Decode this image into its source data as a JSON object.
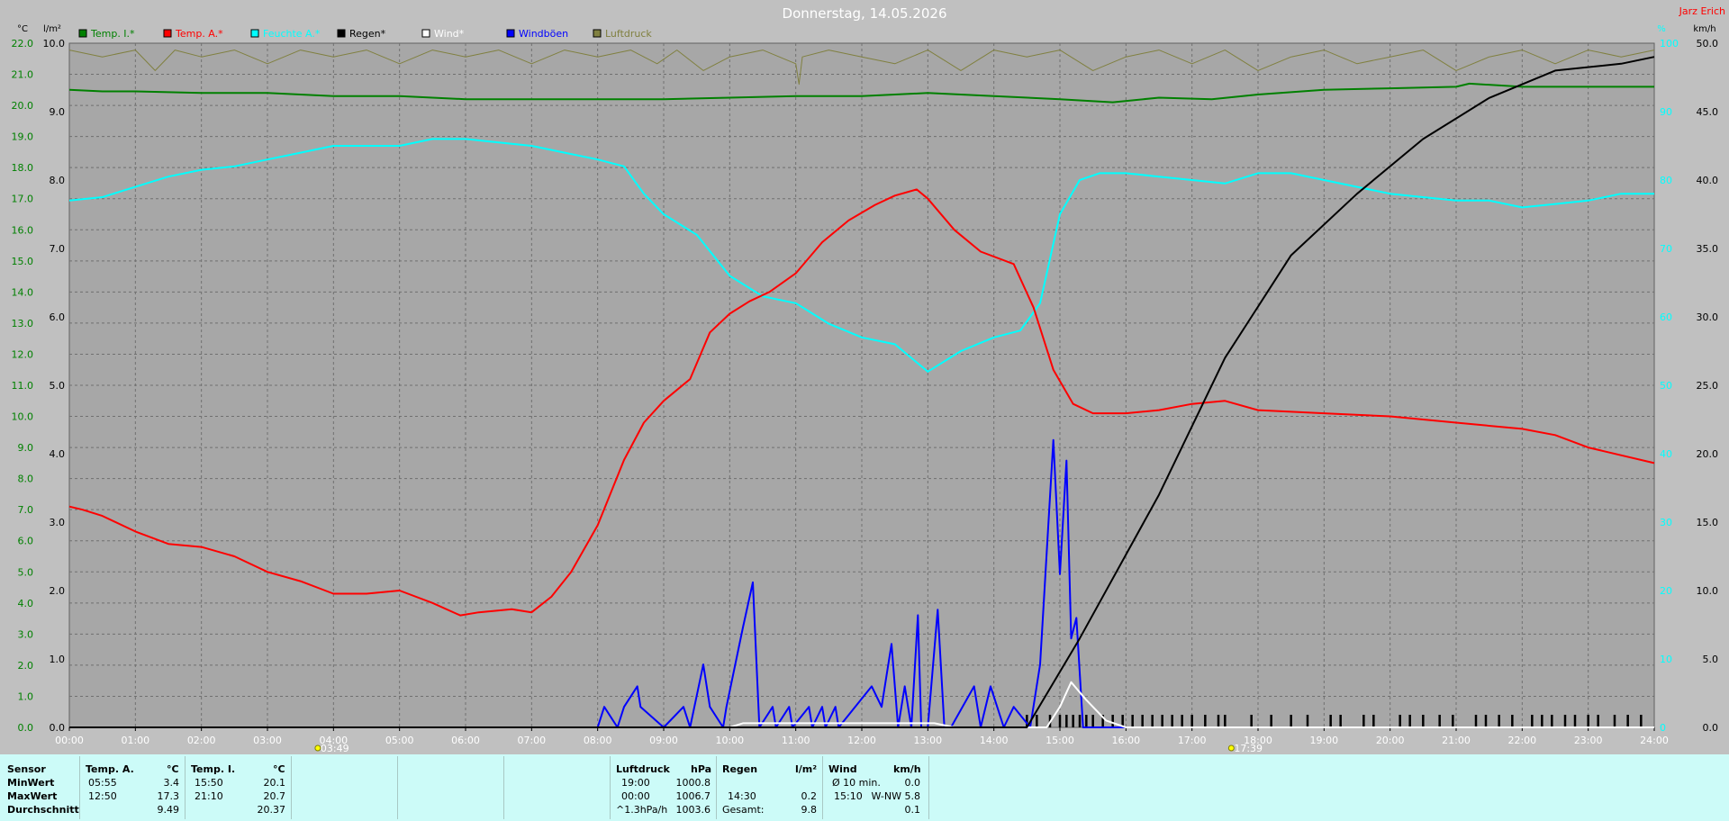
{
  "header": {
    "title": "Donnerstag, 14.05.2026",
    "author": "Jarz Erich",
    "left_unit_temp": "°C",
    "left_unit_rain": "l/m²",
    "right_unit_pct": "%",
    "right_unit_wind": "km/h"
  },
  "legend": [
    {
      "label": "Temp. I.*",
      "color": "#008000"
    },
    {
      "label": "Temp. A.*",
      "color": "#ff0000"
    },
    {
      "label": "Feuchte A.*",
      "color": "#00ffff"
    },
    {
      "label": "Regen*",
      "color": "#000000"
    },
    {
      "label": "Wind*",
      "color": "#ffffff"
    },
    {
      "label": "Windböen",
      "color": "#0000ff"
    },
    {
      "label": "Luftdruck",
      "color": "#808040"
    }
  ],
  "sun": {
    "sunrise": "03:49",
    "sunset": "17:39"
  },
  "chart_data": {
    "type": "line",
    "title": "Donnerstag, 14.05.2026",
    "x_unit": "hours",
    "xlim": [
      0,
      24
    ],
    "x_ticks": [
      "00:00",
      "01:00",
      "02:00",
      "03:00",
      "04:00",
      "05:00",
      "06:00",
      "07:00",
      "08:00",
      "09:00",
      "10:00",
      "11:00",
      "12:00",
      "13:00",
      "14:00",
      "15:00",
      "16:00",
      "17:00",
      "18:00",
      "19:00",
      "20:00",
      "21:00",
      "22:00",
      "23:00",
      "24:00"
    ],
    "axes": {
      "temp_c": {
        "range": [
          0,
          22
        ],
        "ticks": [
          "0.0",
          "1.0",
          "2.0",
          "3.0",
          "4.0",
          "5.0",
          "6.0",
          "7.0",
          "8.0",
          "9.0",
          "10.0",
          "11.0",
          "12.0",
          "13.0",
          "14.0",
          "15.0",
          "16.0",
          "17.0",
          "18.0",
          "19.0",
          "20.0",
          "21.0",
          "22.0"
        ]
      },
      "rain_lm2": {
        "range": [
          0,
          10
        ],
        "ticks": [
          "0.0",
          "1.0",
          "2.0",
          "3.0",
          "4.0",
          "5.0",
          "6.0",
          "7.0",
          "8.0",
          "9.0",
          "10.0"
        ]
      },
      "humidity_pct": {
        "range": [
          0,
          100
        ],
        "ticks": [
          "0",
          "10",
          "20",
          "30",
          "40",
          "50",
          "60",
          "70",
          "80",
          "90",
          "100"
        ]
      },
      "wind_kmh": {
        "range": [
          0,
          50
        ],
        "ticks": [
          "0.0",
          "5.0",
          "10.0",
          "15.0",
          "20.0",
          "25.0",
          "30.0",
          "35.0",
          "40.0",
          "45.0",
          "50.0"
        ]
      }
    },
    "grid": true,
    "series": [
      {
        "name": "Temp. I.*",
        "axis": "temp_c",
        "color": "#008000",
        "x": [
          0,
          0.5,
          1,
          2,
          3,
          4,
          5,
          6,
          7,
          8,
          9,
          10,
          11,
          12,
          13,
          14,
          15,
          15.8,
          16.5,
          17.3,
          18,
          19,
          20,
          21,
          21.2,
          22,
          23,
          24
        ],
        "y": [
          20.5,
          20.45,
          20.45,
          20.4,
          20.4,
          20.3,
          20.3,
          20.2,
          20.2,
          20.2,
          20.2,
          20.25,
          20.3,
          20.3,
          20.4,
          20.3,
          20.2,
          20.1,
          20.25,
          20.2,
          20.35,
          20.5,
          20.55,
          20.6,
          20.7,
          20.6,
          20.6,
          20.6
        ]
      },
      {
        "name": "Temp. A.*",
        "axis": "temp_c",
        "color": "#ff0000",
        "x": [
          0,
          0.2,
          0.5,
          1,
          1.5,
          2,
          2.5,
          3,
          3.5,
          4,
          4.5,
          5,
          5.5,
          5.92,
          6.2,
          6.7,
          7,
          7.3,
          7.6,
          8,
          8.4,
          8.7,
          9,
          9.4,
          9.7,
          10,
          10.3,
          10.6,
          11,
          11.4,
          11.8,
          12.2,
          12.5,
          12.83,
          13,
          13.4,
          13.8,
          14.3,
          14.6,
          14.9,
          15.2,
          15.5,
          16,
          16.5,
          17,
          17.5,
          18,
          19,
          20,
          21,
          22,
          22.5,
          23,
          24
        ],
        "y": [
          7.1,
          7.0,
          6.8,
          6.3,
          5.9,
          5.8,
          5.5,
          5.0,
          4.7,
          4.3,
          4.3,
          4.4,
          4.0,
          3.6,
          3.7,
          3.8,
          3.7,
          4.2,
          5.0,
          6.5,
          8.6,
          9.8,
          10.5,
          11.2,
          12.7,
          13.3,
          13.7,
          14.0,
          14.6,
          15.6,
          16.3,
          16.8,
          17.1,
          17.3,
          17.0,
          16.0,
          15.3,
          14.9,
          13.5,
          11.5,
          10.4,
          10.1,
          10.1,
          10.2,
          10.4,
          10.5,
          10.2,
          10.1,
          10.0,
          9.8,
          9.6,
          9.4,
          9.0,
          8.5
        ]
      },
      {
        "name": "Feuchte A.*",
        "axis": "humidity_pct",
        "color": "#00ffff",
        "x": [
          0,
          0.5,
          1,
          1.5,
          2,
          2.5,
          3,
          3.5,
          4,
          4.5,
          5,
          5.5,
          6,
          6.5,
          7,
          7.5,
          8,
          8.4,
          8.7,
          9,
          9.5,
          10,
          10.5,
          11,
          11.5,
          12,
          12.5,
          13,
          13.5,
          14,
          14.4,
          14.7,
          15,
          15.3,
          15.6,
          16,
          16.5,
          17,
          17.5,
          18,
          18.5,
          19,
          19.5,
          20,
          20.5,
          21,
          21.5,
          22,
          22.5,
          23,
          23.5,
          24
        ],
        "y": [
          77,
          77.5,
          79,
          80.5,
          81.5,
          82,
          83,
          84,
          85,
          85,
          85,
          86,
          86,
          85.5,
          85,
          84,
          83,
          82,
          78,
          75,
          72,
          66,
          63,
          62,
          59,
          57,
          56,
          52,
          55,
          57,
          58,
          62,
          75,
          80,
          81,
          81,
          80.5,
          80,
          79.5,
          81,
          81,
          80,
          79,
          78,
          77.5,
          77,
          77,
          76,
          76.5,
          77,
          78,
          78
        ]
      },
      {
        "name": "Regen*",
        "axis": "rain_lm2",
        "color": "#000000",
        "x": [
          0,
          14.5,
          15.3,
          16.5,
          17.5,
          18.5,
          19.5,
          20.5,
          21.5,
          22.5,
          23.5,
          24
        ],
        "y": [
          0,
          0,
          1.3,
          3.4,
          5.4,
          6.9,
          7.8,
          8.6,
          9.2,
          9.6,
          9.7,
          9.8
        ]
      },
      {
        "name": "Wind*",
        "axis": "wind_kmh",
        "color": "#ffffff",
        "x": [
          0,
          10.0,
          10.2,
          13.1,
          13.4,
          14.8,
          15.0,
          15.17,
          15.4,
          15.7,
          16.0,
          24
        ],
        "y": [
          0,
          0,
          0.3,
          0.3,
          0,
          0,
          1.5,
          3.3,
          2.0,
          0.5,
          0,
          0
        ]
      },
      {
        "name": "Windböen",
        "axis": "wind_kmh",
        "color": "#0000ff",
        "x": [
          0,
          8.0,
          8.1,
          8.3,
          8.4,
          8.6,
          8.65,
          9.0,
          9.3,
          9.4,
          9.6,
          9.7,
          9.9,
          9.95,
          10.2,
          10.35,
          10.45,
          10.65,
          10.7,
          10.9,
          10.95,
          11.2,
          11.25,
          11.4,
          11.45,
          11.6,
          11.65,
          12.15,
          12.3,
          12.45,
          12.55,
          12.65,
          12.75,
          12.85,
          12.9,
          13.0,
          13.15,
          13.25,
          13.35,
          13.7,
          13.8,
          13.95,
          14.15,
          14.3,
          14.55,
          14.7,
          14.9,
          15.0,
          15.1,
          15.17,
          15.25,
          15.35,
          15.45,
          15.6,
          24
        ],
        "y": [
          0,
          0,
          1.5,
          0,
          1.5,
          3.0,
          1.5,
          0,
          1.5,
          0,
          4.6,
          1.5,
          0,
          1.5,
          7.3,
          10.6,
          0,
          1.5,
          0,
          1.5,
          0,
          1.5,
          0,
          1.5,
          0,
          1.5,
          0,
          3.0,
          1.5,
          6.1,
          0,
          3.0,
          0,
          8.2,
          0,
          0,
          8.6,
          0,
          0,
          3.0,
          0,
          3.0,
          0,
          1.5,
          0,
          4.6,
          21.0,
          11.2,
          19.5,
          6.5,
          8.0,
          0,
          0,
          0,
          0
        ]
      },
      {
        "name": "Luftdruck",
        "axis": "humidity_pct",
        "color": "#808040",
        "x": [
          0,
          0.5,
          1,
          1.3,
          1.6,
          2,
          2.5,
          3,
          3.5,
          4,
          4.5,
          5,
          5.5,
          6,
          6.5,
          7,
          7.5,
          8,
          8.5,
          8.9,
          9.2,
          9.6,
          10,
          10.5,
          11,
          11.05,
          11.1,
          11.5,
          12,
          12.5,
          13,
          13.5,
          14,
          14.5,
          15,
          15.5,
          16,
          16.5,
          17,
          17.5,
          18,
          18.5,
          19,
          19.5,
          20,
          20.5,
          21,
          21.5,
          22,
          22.5,
          23,
          23.5,
          24
        ],
        "y": [
          99,
          98,
          99,
          96,
          99,
          98,
          99,
          97,
          99,
          98,
          99,
          97,
          99,
          98,
          99,
          97,
          99,
          98,
          99,
          97,
          99,
          96,
          98,
          99,
          97,
          94,
          98,
          99,
          98,
          97,
          99,
          96,
          99,
          98,
          99,
          96,
          98,
          99,
          97,
          99,
          96,
          98,
          99,
          97,
          98,
          99,
          96,
          98,
          99,
          97,
          99,
          98,
          99
        ]
      }
    ],
    "rain_marks_hours": [
      14.5,
      14.65,
      14.85,
      15.0,
      15.1,
      15.2,
      15.3,
      15.4,
      15.5,
      15.65,
      15.8,
      15.95,
      16.1,
      16.25,
      16.4,
      16.55,
      16.7,
      16.85,
      17.0,
      17.2,
      17.4,
      17.5,
      17.9,
      18.2,
      18.5,
      18.75,
      19.1,
      19.25,
      19.6,
      19.75,
      20.15,
      20.3,
      20.5,
      20.75,
      20.95,
      21.3,
      21.45,
      21.65,
      21.85,
      22.15,
      22.3,
      22.45,
      22.65,
      22.8,
      23.0,
      23.15,
      23.4,
      23.6,
      23.8
    ]
  },
  "stats": {
    "labels": {
      "sensor": "Sensor",
      "min": "MinWert",
      "max": "MaxWert",
      "avg": "Durchschnitt"
    },
    "temp_a": {
      "title": "Temp. A.",
      "unit": "°C",
      "min_time": "05:55",
      "min_val": "3.4",
      "max_time": "12:50",
      "max_val": "17.3",
      "avg": "9.49"
    },
    "temp_i": {
      "title": "Temp. I.",
      "unit": "°C",
      "min_time": "15:50",
      "min_val": "20.1",
      "max_time": "21:10",
      "max_val": "20.7",
      "avg": "20.37"
    },
    "pressure": {
      "title": "Luftdruck",
      "unit": "hPa",
      "min_time": "19:00",
      "min_val": "1000.8",
      "max_time": "00:00",
      "max_val": "1006.7",
      "trend_label": "^1.3hPa/h",
      "trend_val": "1003.6"
    },
    "rain": {
      "title": "Regen",
      "unit": "l/m²",
      "max_time": "14:30",
      "max_val": "0.2",
      "total_label": "Gesamt:",
      "total_val": "9.8"
    },
    "wind": {
      "title": "Wind",
      "unit": "km/h",
      "avg_label": "Ø 10 min.",
      "avg_val": "0.0",
      "max_time": "15:10",
      "max_val": "W-NW 5.8",
      "avg_day": "0.1"
    }
  }
}
